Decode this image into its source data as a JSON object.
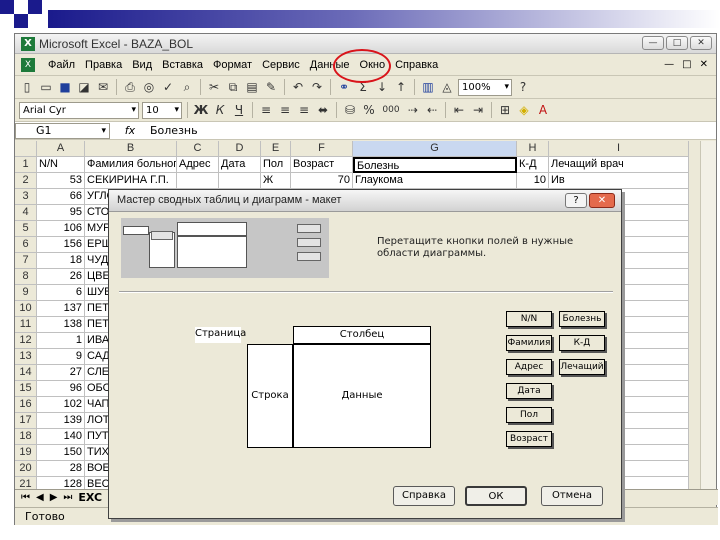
{
  "window": {
    "title": "Microsoft Excel - BAZA_BOL",
    "buttons": [
      "—",
      "□",
      "✕"
    ]
  },
  "menu": {
    "items": [
      "Файл",
      "Правка",
      "Вид",
      "Вставка",
      "Формат",
      "Сервис",
      "Данные",
      "Окно",
      "Справка"
    ],
    "highlighted": "Данные",
    "right_controls": [
      "—",
      "□",
      "✕"
    ]
  },
  "toolbar": {
    "zoom": "100%",
    "font_name": "Arial Cyr",
    "font_size": "10",
    "bold": "Ж",
    "italic": "К",
    "underline": "Ч",
    "percent": "%",
    "thousands": "000"
  },
  "formula_bar": {
    "cell_ref": "G1",
    "fx": "fx",
    "value": "Болезнь"
  },
  "grid": {
    "columns": [
      "A",
      "B",
      "C",
      "D",
      "E",
      "F",
      "G",
      "H",
      "I"
    ],
    "selected_column": "G",
    "header_row": [
      "N/N",
      "Фамилия больного",
      "Адрес",
      "Дата",
      "Пол",
      "Возраст",
      "Болезнь",
      "К-Д",
      "Лечащий врач"
    ],
    "rows": [
      {
        "n": "2",
        "cells": [
          "53",
          "СЕКИРИНА Г.П.",
          "",
          "",
          "Ж",
          "70",
          "Глаукома",
          "10",
          "Ив"
        ]
      },
      {
        "n": "3",
        "cells": [
          "66",
          "УГЛОЕ",
          "",
          "",
          "",
          "",
          "",
          "",
          ""
        ]
      },
      {
        "n": "4",
        "cells": [
          "95",
          "СТОНЗ",
          "",
          "",
          "",
          "",
          "",
          "",
          ""
        ]
      },
      {
        "n": "5",
        "cells": [
          "106",
          "МУРЬ",
          "",
          "",
          "",
          "",
          "",
          "",
          ""
        ]
      },
      {
        "n": "6",
        "cells": [
          "156",
          "ЕРШО",
          "",
          "",
          "",
          "",
          "",
          "",
          ""
        ]
      },
      {
        "n": "7",
        "cells": [
          "18",
          "ЧУДИН",
          "",
          "",
          "",
          "",
          "",
          "",
          ""
        ]
      },
      {
        "n": "8",
        "cells": [
          "26",
          "ЦВЕТ",
          "",
          "",
          "",
          "",
          "",
          "",
          ""
        ]
      },
      {
        "n": "9",
        "cells": [
          "6",
          "ШУЕН",
          "",
          "",
          "",
          "",
          "",
          "",
          ""
        ]
      },
      {
        "n": "10",
        "cells": [
          "137",
          "ПЕТРС",
          "",
          "",
          "",
          "",
          "",
          "",
          ""
        ]
      },
      {
        "n": "11",
        "cells": [
          "138",
          "ПЕТРУ",
          "",
          "",
          "",
          "",
          "",
          "",
          ""
        ]
      },
      {
        "n": "12",
        "cells": [
          "1",
          "ИВАН",
          "",
          "",
          "",
          "",
          "",
          "",
          "в"
        ]
      },
      {
        "n": "13",
        "cells": [
          "9",
          "САДИ",
          "",
          "",
          "",
          "",
          "",
          "",
          "в"
        ]
      },
      {
        "n": "14",
        "cells": [
          "27",
          "СЛЕП",
          "",
          "",
          "",
          "",
          "",
          "",
          "в"
        ]
      },
      {
        "n": "15",
        "cells": [
          "96",
          "ОБОР",
          "",
          "",
          "",
          "",
          "",
          "",
          "в"
        ]
      },
      {
        "n": "16",
        "cells": [
          "102",
          "ЧАПА",
          "",
          "",
          "",
          "",
          "",
          "",
          "в"
        ]
      },
      {
        "n": "17",
        "cells": [
          "139",
          "ЛОТЫ",
          "",
          "",
          "",
          "",
          "",
          "",
          "в"
        ]
      },
      {
        "n": "18",
        "cells": [
          "140",
          "ПУТИ",
          "",
          "",
          "",
          "",
          "",
          "",
          "в"
        ]
      },
      {
        "n": "19",
        "cells": [
          "150",
          "ТИХОН",
          "",
          "",
          "",
          "",
          "",
          "",
          "в"
        ]
      },
      {
        "n": "20",
        "cells": [
          "28",
          "ВОЕЙ",
          "",
          "",
          "",
          "",
          "",
          "",
          "в"
        ]
      },
      {
        "n": "21",
        "cells": [
          "128",
          "ВЕСЕ",
          "",
          "",
          "",
          "",
          "",
          "",
          "в"
        ]
      }
    ]
  },
  "sheet_tab": "EXC",
  "status": "Готово",
  "dialog": {
    "title": "Мастер сводных таблиц и диаграмм - макет",
    "help": "?",
    "close": "✕",
    "hint": "Перетащите кнопки полей в нужные области диаграммы.",
    "areas": {
      "page": "Страница",
      "column": "Столбец",
      "row": "Строка",
      "data": "Данные"
    },
    "fields_left": [
      "N/N",
      "Фамилия",
      "Адрес",
      "Дата",
      "Пол",
      "Возраст"
    ],
    "fields_right": [
      "Болезнь",
      "К-Д",
      "Лечащий"
    ],
    "buttons": {
      "help": "Справка",
      "ok": "ОК",
      "cancel": "Отмена"
    }
  }
}
